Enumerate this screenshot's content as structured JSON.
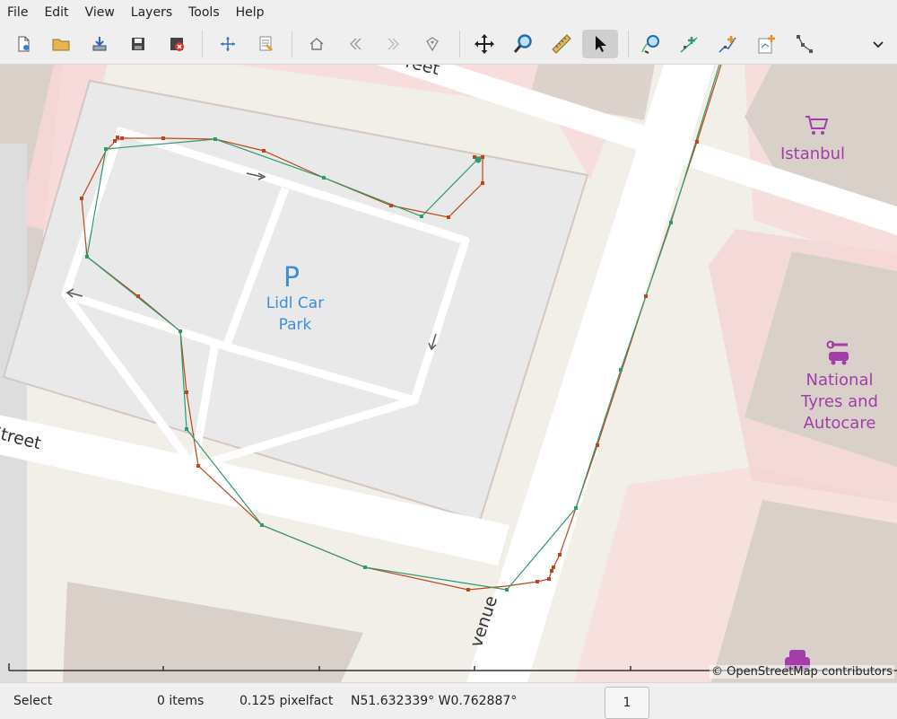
{
  "menu": [
    "File",
    "Edit",
    "View",
    "Layers",
    "Tools",
    "Help"
  ],
  "toolbar": {
    "icons": [
      "new-icon",
      "open-icon",
      "import-icon",
      "save-icon",
      "close-icon",
      "zoom-fit-icon",
      "layer-properties-icon",
      "home-icon",
      "back-icon",
      "forward-icon",
      "waypoint-icon",
      "pan-icon",
      "zoom-icon",
      "ruler-icon",
      "select-icon",
      "split-track-icon",
      "add-point-icon",
      "add-track-icon",
      "new-layer-icon",
      "route-points-icon",
      "overflow-chevron-icon"
    ],
    "active": "select-icon"
  },
  "map": {
    "labels": {
      "parking_symbol": "P",
      "parking_name": "Lidl Car Park",
      "shop": "Istanbul",
      "garage": "National Tyres and Autocare",
      "street_left": "Street",
      "street_top": "reet",
      "avenue": "venue"
    },
    "attribution": "© OpenStreetMap contributors",
    "colors": {
      "track_red": "#c0461a",
      "track_green": "#2a9c70",
      "road": "#ffffff",
      "building": "#d9d0c9",
      "parking": "#eeeeee",
      "poi": "#a23daa",
      "parking_label": "#3c8fd8"
    }
  },
  "status": {
    "mode": "Select",
    "items": "0 items",
    "scale": "0.125 pixelfact",
    "coords": "N51.632339° W0.762887°",
    "page": "1"
  }
}
